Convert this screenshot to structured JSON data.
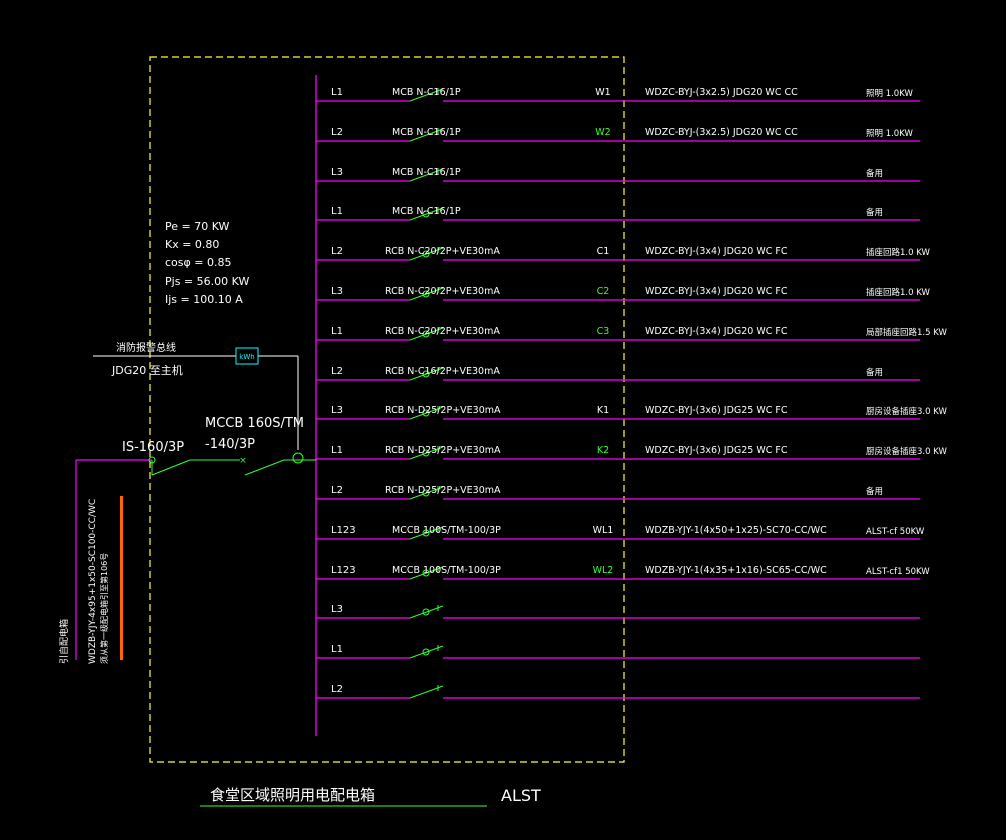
{
  "colors": {
    "background": "#000000",
    "bus": "#ff00ff",
    "switch": "#33ff33",
    "border": "#ffff33",
    "text": "#ffffff",
    "green_text": "#33ff33",
    "orange_bar": "#ff6600",
    "meter_box": "#00ffff"
  },
  "params": {
    "pe": "Pe = 70 KW",
    "kx": "Kx = 0.80",
    "cos": "cosφ = 0.85",
    "pjs": "Pjs = 56.00 KW",
    "ijs": "Ijs = 100.10 A"
  },
  "fire_link": {
    "label": "消防报警总线",
    "conduit": "JDG20 至主机"
  },
  "meter": {
    "label": "kWh"
  },
  "incoming": {
    "isolator": "IS-160/3P",
    "mccb_line1": "MCCB 160S/TM",
    "mccb_line2": "-140/3P",
    "cable": "WDZB-YJY-4x95+1x50-SC100-CC/WC",
    "source": "引自配电箱",
    "note": "须从第一级配电箱引至第106号"
  },
  "circuits": [
    {
      "phase": "L1",
      "breaker": "MCB N-C16/1P",
      "id": "W1",
      "id_green": false,
      "cable": "WDZC-BYJ-(3x2.5) JDG20 WC CC",
      "load": "照明 1.0KW",
      "switch": "open"
    },
    {
      "phase": "L2",
      "breaker": "MCB N-C16/1P",
      "id": "W2",
      "id_green": true,
      "cable": "WDZC-BYJ-(3x2.5) JDG20 WC CC",
      "load": "照明 1.0KW",
      "switch": "open"
    },
    {
      "phase": "L3",
      "breaker": "MCB N-C16/1P",
      "id": "",
      "id_green": false,
      "cable": "",
      "load": "备用",
      "switch": "open"
    },
    {
      "phase": "L1",
      "breaker": "MCB N-C16/1P",
      "id": "",
      "id_green": false,
      "cable": "",
      "load": "备用",
      "switch": "rcd"
    },
    {
      "phase": "L2",
      "breaker": "RCB N-C20/2P+VE30mA",
      "id": "C1",
      "id_green": false,
      "cable": "WDZC-BYJ-(3x4) JDG20 WC FC",
      "load": "插座回路1.0 KW",
      "switch": "rcd"
    },
    {
      "phase": "L3",
      "breaker": "RCB N-C20/2P+VE30mA",
      "id": "C2",
      "id_green": true,
      "cable": "WDZC-BYJ-(3x4) JDG20 WC FC",
      "load": "插座回路1.0 KW",
      "switch": "rcd"
    },
    {
      "phase": "L1",
      "breaker": "RCB N-C20/2P+VE30mA",
      "id": "C3",
      "id_green": true,
      "cable": "WDZC-BYJ-(3x4) JDG20 WC FC",
      "load": "局部插座回路1.5 KW",
      "switch": "rcd"
    },
    {
      "phase": "L2",
      "breaker": "RCB N-C16/2P+VE30mA",
      "id": "",
      "id_green": false,
      "cable": "",
      "load": "备用",
      "switch": "rcd"
    },
    {
      "phase": "L3",
      "breaker": "RCB N-D25/2P+VE30mA",
      "id": "K1",
      "id_green": false,
      "cable": "WDZC-BYJ-(3x6) JDG25 WC FC",
      "load": "厨房设备插座3.0 KW",
      "switch": "rcd"
    },
    {
      "phase": "L1",
      "breaker": "RCB N-D25/2P+VE30mA",
      "id": "K2",
      "id_green": true,
      "cable": "WDZC-BYJ-(3x6) JDG25 WC FC",
      "load": "厨房设备插座3.0 KW",
      "switch": "rcd"
    },
    {
      "phase": "L2",
      "breaker": "RCB N-D25/2P+VE30mA",
      "id": "",
      "id_green": false,
      "cable": "",
      "load": "备用",
      "switch": "rcd"
    },
    {
      "phase": "L123",
      "breaker": "MCCB 100S/TM-100/3P",
      "id": "WL1",
      "id_green": false,
      "cable": "WDZB-YJY-1(4x50+1x25)-SC70-CC/WC",
      "load": "ALST-cf 50KW",
      "switch": "rcd"
    },
    {
      "phase": "L123",
      "breaker": "MCCB 100S/TM-100/3P",
      "id": "WL2",
      "id_green": true,
      "cable": "WDZB-YJY-1(4x35+1x16)-SC65-CC/WC",
      "load": "ALST-cf1 50KW",
      "switch": "rcd"
    },
    {
      "phase": "L3",
      "breaker": "",
      "id": "",
      "id_green": false,
      "cable": "",
      "load": "",
      "switch": "rcd"
    },
    {
      "phase": "L1",
      "breaker": "",
      "id": "",
      "id_green": false,
      "cable": "",
      "load": "",
      "switch": "rcd"
    },
    {
      "phase": "L2",
      "breaker": "",
      "id": "",
      "id_green": false,
      "cable": "",
      "load": "",
      "switch": "open"
    }
  ],
  "title": {
    "name": "食堂区域照明用电配电箱",
    "code": "ALST"
  }
}
